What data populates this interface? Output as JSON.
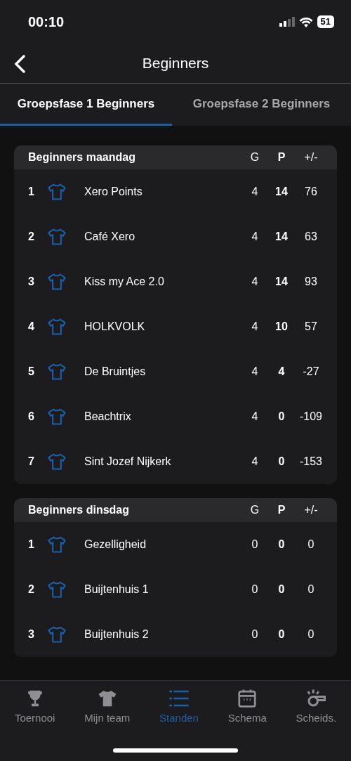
{
  "status_bar": {
    "time": "00:10",
    "battery": "51"
  },
  "nav": {
    "title": "Beginners"
  },
  "tabs": [
    {
      "label": "Groepsfase 1 Beginners",
      "selected": true
    },
    {
      "label": "Groepsfase 2 Beginners",
      "selected": false
    }
  ],
  "groups": [
    {
      "title": "Beginners maandag",
      "columns": [
        "G",
        "P",
        "+/-"
      ],
      "rows": [
        {
          "rank": "1",
          "team": "Xero Points",
          "g": "4",
          "p": "14",
          "diff": "76"
        },
        {
          "rank": "2",
          "team": "Café Xero",
          "g": "4",
          "p": "14",
          "diff": "63"
        },
        {
          "rank": "3",
          "team": "Kiss my Ace 2.0",
          "g": "4",
          "p": "14",
          "diff": "93"
        },
        {
          "rank": "4",
          "team": "HOLKVOLK",
          "g": "4",
          "p": "10",
          "diff": "57"
        },
        {
          "rank": "5",
          "team": "De Bruintjes",
          "g": "4",
          "p": "4",
          "diff": "-27"
        },
        {
          "rank": "6",
          "team": "Beachtrix",
          "g": "4",
          "p": "0",
          "diff": "-109"
        },
        {
          "rank": "7",
          "team": "Sint Jozef Nijkerk",
          "g": "4",
          "p": "0",
          "diff": "-153"
        }
      ]
    },
    {
      "title": "Beginners dinsdag",
      "columns": [
        "G",
        "P",
        "+/-"
      ],
      "rows": [
        {
          "rank": "1",
          "team": "Gezelligheid",
          "g": "0",
          "p": "0",
          "diff": "0"
        },
        {
          "rank": "2",
          "team": "Buijtenhuis 1",
          "g": "0",
          "p": "0",
          "diff": "0"
        },
        {
          "rank": "3",
          "team": "Buijtenhuis 2",
          "g": "0",
          "p": "0",
          "diff": "0"
        }
      ]
    }
  ],
  "tab_bar": [
    {
      "kind": "trophy",
      "label": "Toernooi",
      "selected": false
    },
    {
      "kind": "shirt",
      "label": "Mijn team",
      "selected": false
    },
    {
      "kind": "list",
      "label": "Standen",
      "selected": true
    },
    {
      "kind": "calendar",
      "label": "Schema",
      "selected": false
    },
    {
      "kind": "whistle",
      "label": "Scheids.",
      "selected": false
    }
  ]
}
